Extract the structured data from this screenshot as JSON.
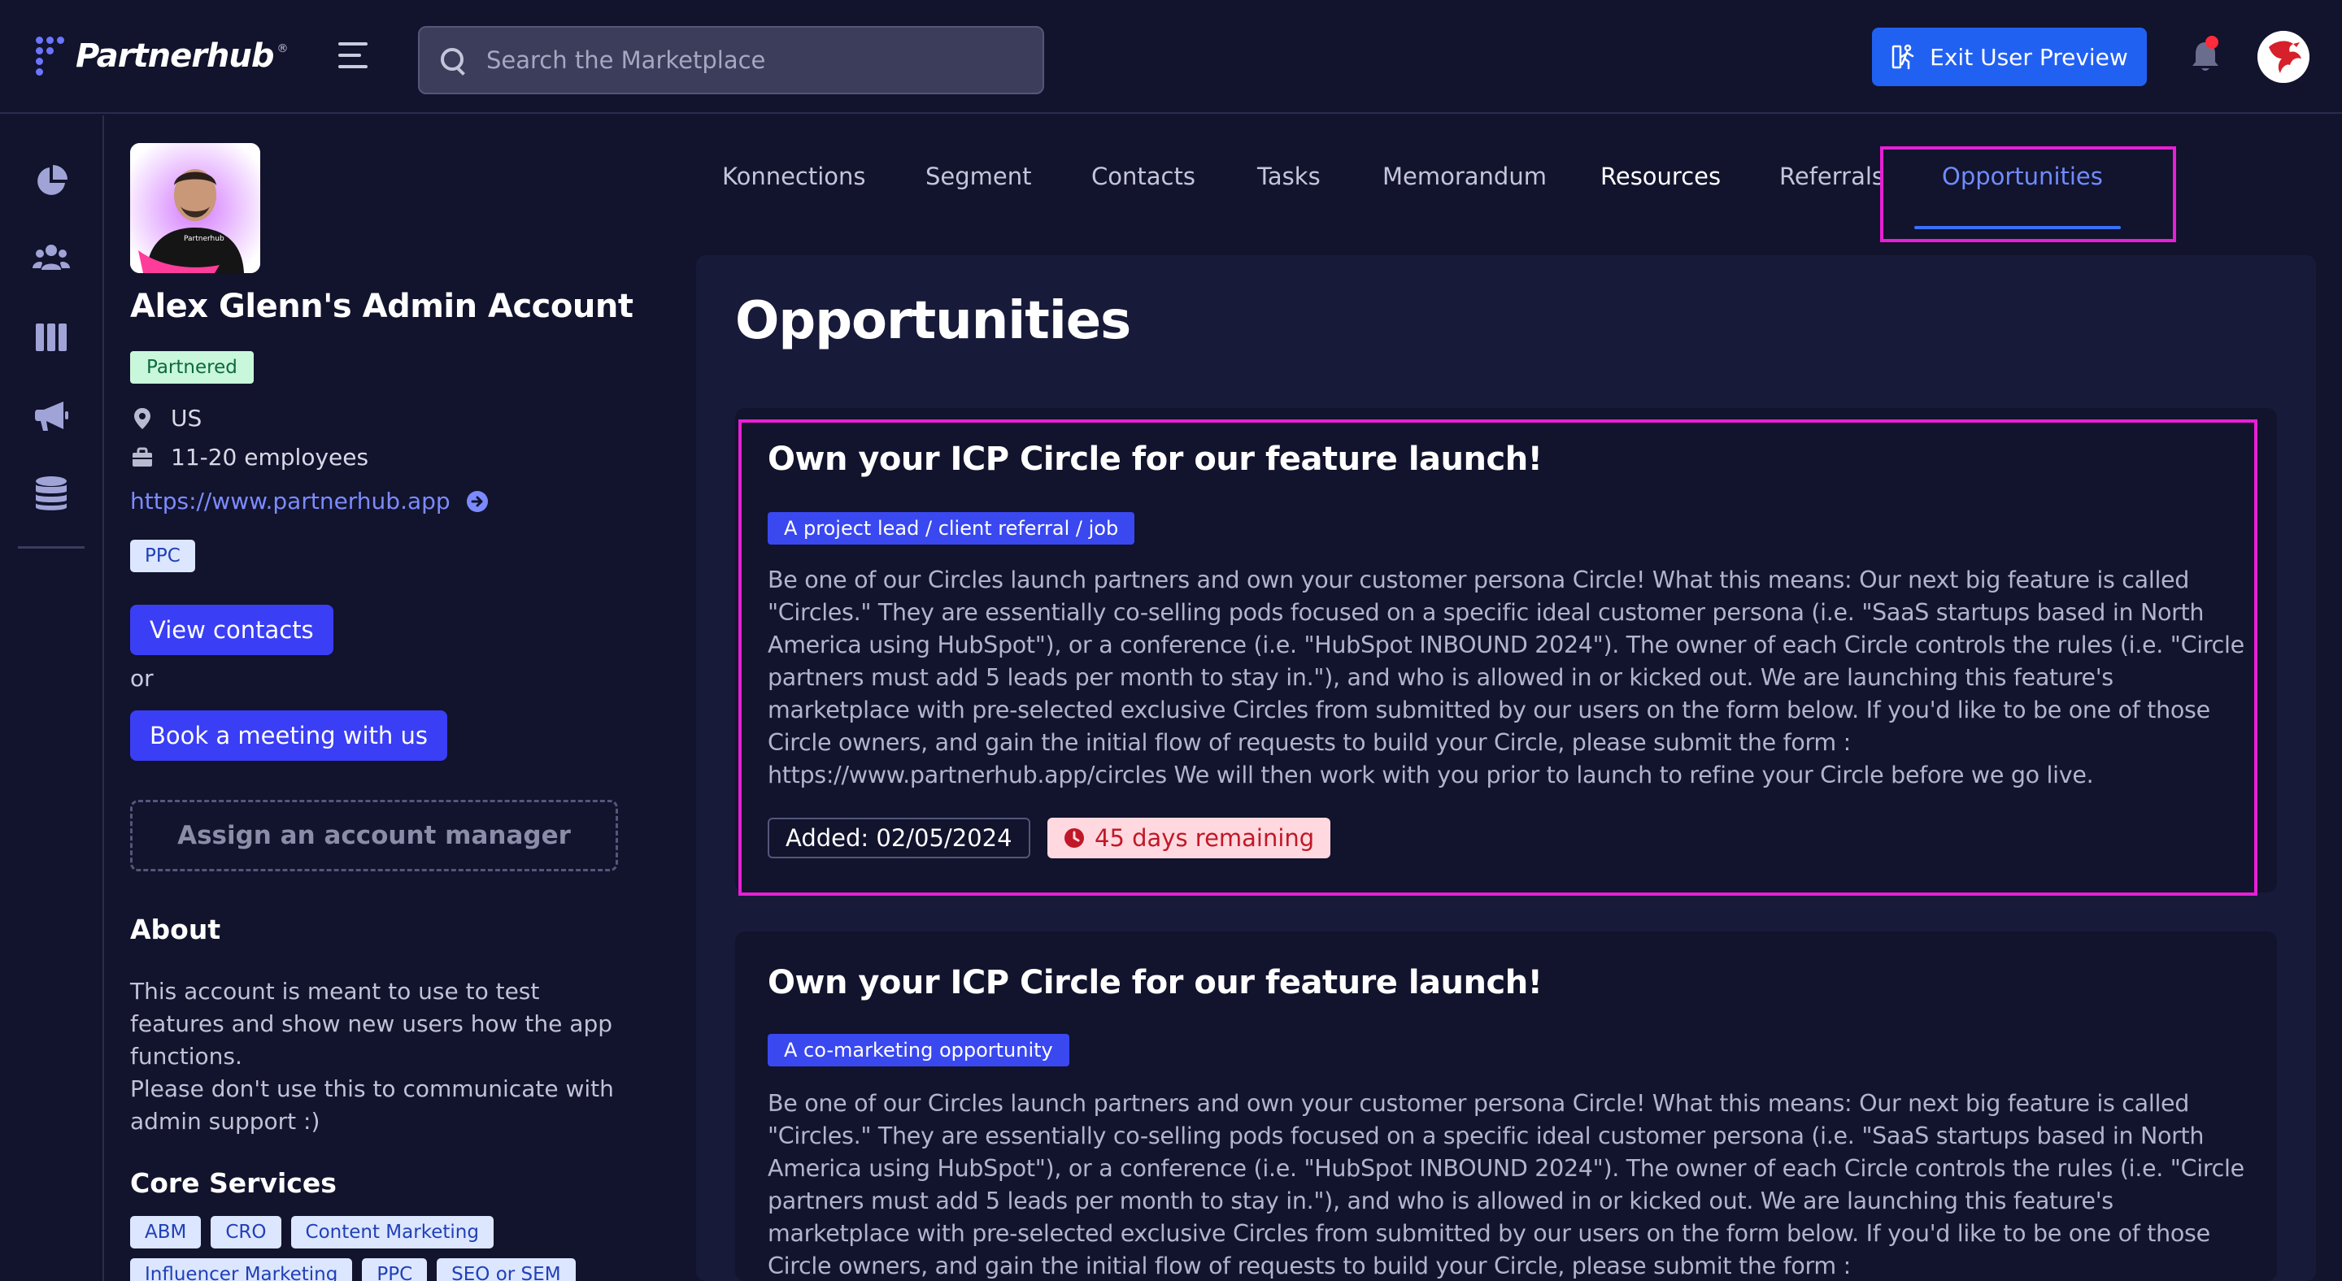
{
  "header": {
    "logo_text": "Partnerhub",
    "logo_reg": "®",
    "search_placeholder": "Search the Marketplace",
    "exit_label": "Exit User Preview"
  },
  "profile": {
    "name": "Alex Glenn's Admin Account",
    "status": "Partnered",
    "location": "US",
    "size": "11-20 employees",
    "website": "https://www.partnerhub.app",
    "tag": "PPC",
    "view_contacts": "View contacts",
    "or": "or",
    "book_meeting": "Book a meeting with us",
    "assign_manager": "Assign an account manager",
    "about_title": "About",
    "about_p1": "This account is meant to use to test features and show new users how the app functions.",
    "about_p2": "Please don't use this to communicate with admin support :)",
    "core_title": "Core Services",
    "core_services": [
      "ABM",
      "CRO",
      "Content Marketing",
      "Influencer Marketing",
      "PPC",
      "SEO or SEM"
    ]
  },
  "tabs": [
    "Konnections",
    "Segment",
    "Contacts",
    "Tasks",
    "Memorandum",
    "Resources",
    "Referrals",
    "Opportunities"
  ],
  "active_tab": "Opportunities",
  "page_title": "Opportunities",
  "opportunities": [
    {
      "title": "Own your ICP Circle for our feature launch!",
      "type": "A project lead / client referral / job",
      "description": "Be one of our Circles launch partners and own your customer persona Circle! What this means: Our next big feature is called \"Circles.\" They are essentially co-selling pods focused on a specific ideal customer persona (i.e. \"SaaS startups based in North America using HubSpot\"), or a conference (i.e. \"HubSpot INBOUND 2024\"). The owner of each Circle controls the rules (i.e. \"Circle partners must add 5 leads per month to stay in.\"), and who is allowed in or kicked out. We are launching this feature's marketplace with pre-selected exclusive Circles from submitted by our users on the form below. If you'd like to be one of those Circle owners, and gain the initial flow of requests to build your Circle, please submit the form : https://www.partnerhub.app/circles We will then work with you prior to launch to refine your Circle before we go live.",
      "added": "Added: 02/05/2024",
      "remaining": "45 days remaining"
    },
    {
      "title": "Own your ICP Circle for our feature launch!",
      "type": "A co-marketing opportunity",
      "description": "Be one of our Circles launch partners and own your customer persona Circle! What this means: Our next big feature is called \"Circles.\" They are essentially co-selling pods focused on a specific ideal customer persona (i.e. \"SaaS startups based in North America using HubSpot\"), or a conference (i.e. \"HubSpot INBOUND 2024\"). The owner of each Circle controls the rules (i.e. \"Circle partners must add 5 leads per month to stay in.\"), and who is allowed in or kicked out. We are launching this feature's marketplace with pre-selected exclusive Circles from submitted by our users on the form below. If you'd like to be one of those Circle owners, and gain the initial flow of requests to build your Circle, please submit the form : https://www.partnerhub.app/circles We will then work with you prior to the launch to refine your Circle"
    }
  ],
  "colors": {
    "background": "#12132c",
    "accent": "#3a3ef5",
    "highlight": "#e81fd6",
    "active_tab": "#6f8cff"
  },
  "icons": {
    "logo": "dot-grid-icon",
    "menu": "hamburger-icon",
    "search": "search-icon",
    "exit": "person-walking-icon",
    "notifications": "bell-icon",
    "rail": [
      "pie-chart-icon",
      "users-icon",
      "columns-icon",
      "megaphone-icon",
      "database-icon"
    ],
    "location": "map-pin-icon",
    "size": "briefcase-icon",
    "link": "arrow-circle-icon",
    "clock": "clock-icon"
  }
}
